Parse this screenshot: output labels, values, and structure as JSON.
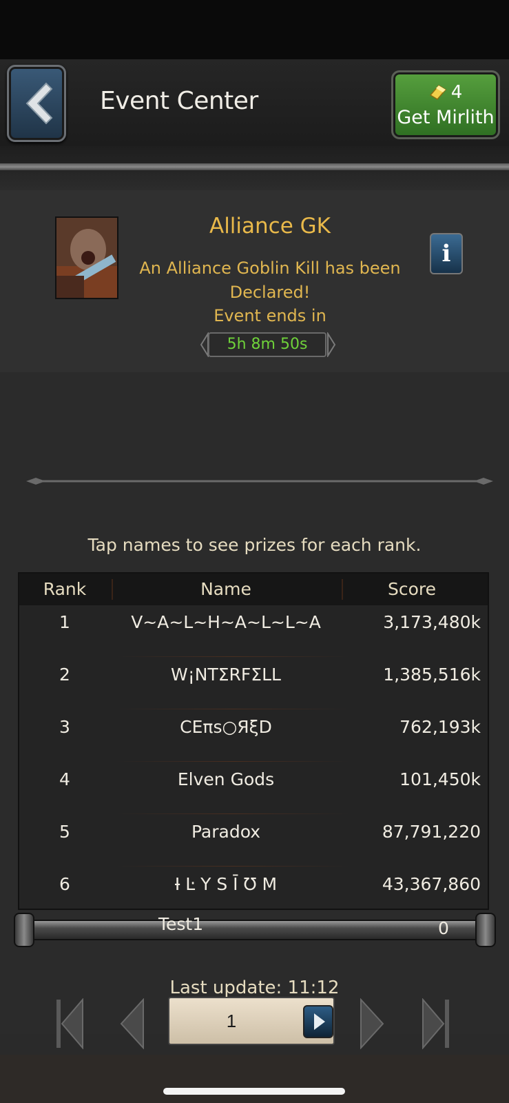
{
  "header": {
    "title": "Event Center",
    "mirlith": {
      "count": "4",
      "label": "Get Mirlith"
    }
  },
  "event": {
    "title": "Alliance GK",
    "description": "An Alliance Goblin Kill has been Declared!",
    "ends_label": "Event ends in",
    "timer": "5h 8m 50s",
    "info_label": "i"
  },
  "leaderboard": {
    "hint": "Tap names to see prizes for each rank.",
    "columns": {
      "rank": "Rank",
      "name": "Name",
      "score": "Score"
    },
    "rows": [
      {
        "rank": "1",
        "name": "V~A~L~H~A~L~L~A",
        "score": "3,173,480k"
      },
      {
        "rank": "2",
        "name": "W¡NTΣRFΣLL",
        "score": "1,385,516k"
      },
      {
        "rank": "3",
        "name": "CEπs○ЯξD",
        "score": "762,193k"
      },
      {
        "rank": "4",
        "name": "Elven Gods",
        "score": "101,450k"
      },
      {
        "rank": "5",
        "name": "Paradox",
        "score": "87,791,220"
      },
      {
        "rank": "6",
        "name": "Ɨ Ŀ Y S Ī Ʊ M",
        "score": "43,367,860"
      }
    ],
    "self": {
      "name": "Test1",
      "score": "0"
    },
    "last_update": "Last update: 11:12",
    "page": "1"
  },
  "colors": {
    "title_gold": "#e9b94a",
    "timer_green": "#6fd23a",
    "mirlith_green": "#3f8a2e",
    "button_blue": "#2d5d86"
  },
  "icons": {
    "back": "chevron-left-icon",
    "mirlith": "gold-bar-icon",
    "info": "info-icon",
    "first": "first-page-icon",
    "prev": "prev-page-icon",
    "next": "next-page-icon",
    "last": "last-page-icon",
    "go": "play-icon"
  }
}
